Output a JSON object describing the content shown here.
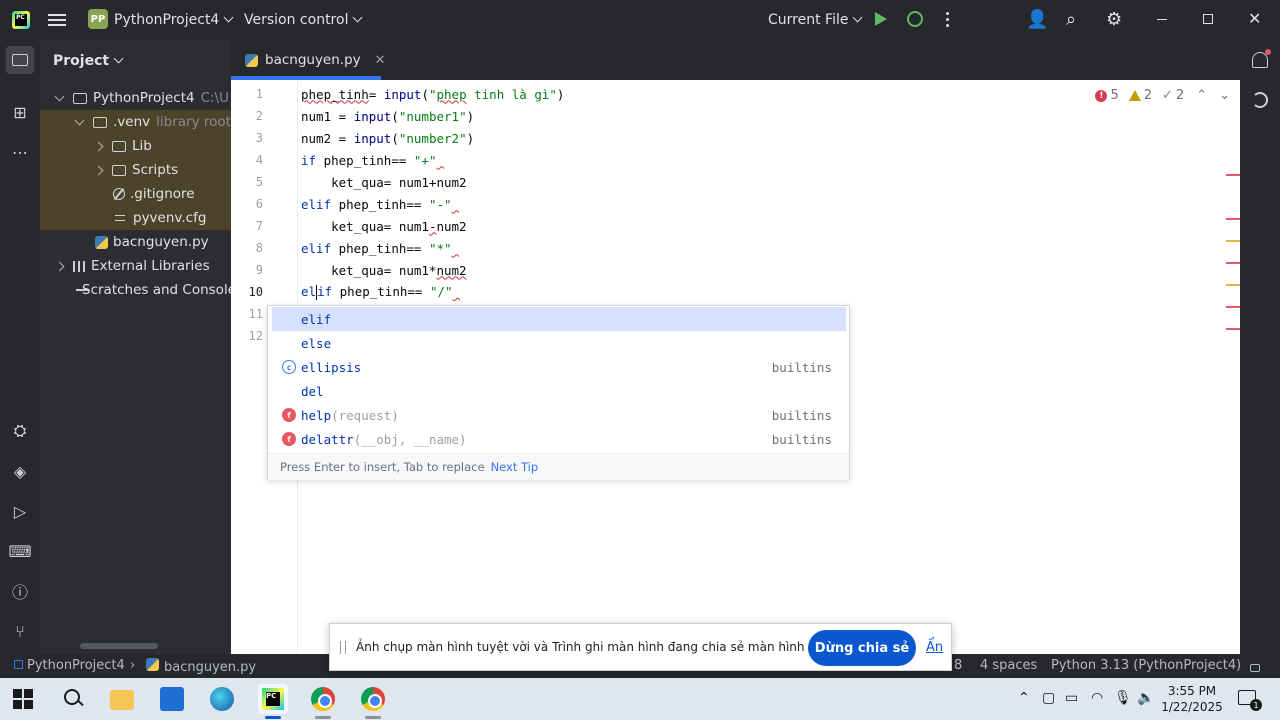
{
  "titlebar": {
    "logo": "PC",
    "project_badge": "PP",
    "project_name": "PythonProject4",
    "version_control": "Version control",
    "run_config": "Current File",
    "icons": [
      "hamburger-icon",
      "run-icon",
      "debug-icon",
      "more-icon",
      "add-user-icon",
      "search-icon",
      "settings-icon",
      "minimize-icon",
      "maximize-icon",
      "close-icon"
    ]
  },
  "project_panel": {
    "title": "Project",
    "tree": [
      {
        "label": "PythonProject4",
        "note": "C:\\U"
      },
      {
        "label": ".venv",
        "note": "library root"
      },
      {
        "label": "Lib"
      },
      {
        "label": "Scripts"
      },
      {
        "label": ".gitignore"
      },
      {
        "label": "pyvenv.cfg"
      },
      {
        "label": "bacnguyen.py"
      },
      {
        "label": "External Libraries"
      },
      {
        "label": "Scratches and Consoles"
      }
    ]
  },
  "editor": {
    "tab_label": "bacnguyen.py",
    "inspections": {
      "errors": "5",
      "warnings": "2",
      "weak": "2"
    },
    "line_numbers": [
      "1",
      "2",
      "3",
      "4",
      "5",
      "6",
      "7",
      "8",
      "9",
      "10",
      "11",
      "12"
    ],
    "lines": [
      "phep_tinh= input(\"phep tinh là gì\")",
      "num1 = input(\"number1\")",
      "num2 = input(\"number2\")",
      "if phep_tinh== \"+\"",
      "    ket_qua= num1+num2",
      "elif phep_tinh== \"-\"",
      "    ket_qua= num1-num2",
      "elif phep_tinh== \"*\"",
      "    ket_qua= num1*num2",
      "elif phep_tinh== \"/\"",
      "",
      ""
    ],
    "colors": {
      "keyword": "#0033b3",
      "string": "#067d17",
      "error": "#db3b4b",
      "warning": "#c29e00"
    }
  },
  "completion": {
    "items": [
      {
        "label": "elif",
        "type": ""
      },
      {
        "label": "else",
        "type": ""
      },
      {
        "label": "ellipsis",
        "type": "builtins"
      },
      {
        "label": "del",
        "type": ""
      },
      {
        "label": "help",
        "hint": "(request)",
        "type": "builtins"
      },
      {
        "label": "delattr",
        "hint": "(__obj, __name)",
        "type": "builtins"
      }
    ],
    "footer": "Press Enter to insert, Tab to replace",
    "next_tip": "Next Tip"
  },
  "statusbar": {
    "project": "PythonProject4",
    "file": "bacnguyen.py",
    "position_tail": "8",
    "indent": "4 spaces",
    "interpreter": "Python 3.13 (PythonProject4)"
  },
  "share_bar": {
    "message": "Ảnh chụp màn hình tuyệt vời và Trình ghi màn hình đang chia sẻ màn hình của bạn.",
    "stop_label": "Dừng chia sẻ",
    "hide_label": "Ẩn"
  },
  "taskbar": {
    "time": "3:55 PM",
    "date": "1/22/2025",
    "notification_count": "1",
    "apps": [
      "windows-start-icon",
      "search-icon",
      "file-explorer-icon",
      "store-icon",
      "edge-icon",
      "pycharm-icon",
      "chrome-icon",
      "chrome-icon"
    ]
  }
}
